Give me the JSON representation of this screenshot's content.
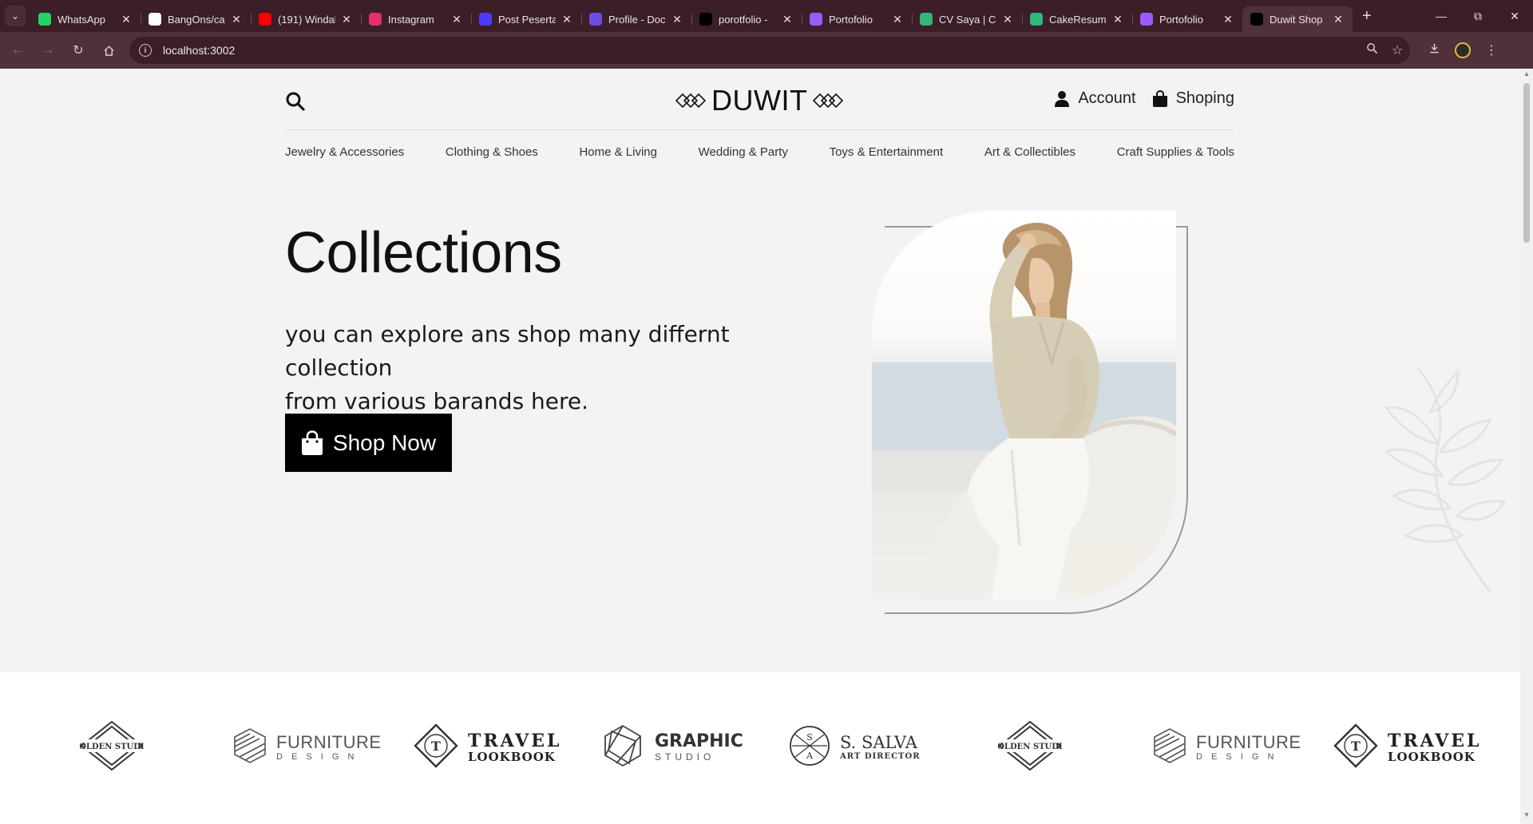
{
  "browser": {
    "tabs": [
      {
        "title": "WhatsApp",
        "icon": "whatsapp-icon",
        "color": "#25d366"
      },
      {
        "title": "BangOns/ca",
        "icon": "github-icon",
        "color": "#ffffff"
      },
      {
        "title": "(191) Windal",
        "icon": "youtube-icon",
        "color": "#ff0000"
      },
      {
        "title": "Instagram",
        "icon": "instagram-icon",
        "color": "#e1306c"
      },
      {
        "title": "Post Peserta",
        "icon": "zoom-icon",
        "color": "#4b3bff"
      },
      {
        "title": "Profile - Doc",
        "icon": "doc-icon",
        "color": "#6c4ee0"
      },
      {
        "title": "porotfolio - ",
        "icon": "vercel-icon",
        "color": "#000000"
      },
      {
        "title": "Portofolio",
        "icon": "vite-icon",
        "color": "#9b5cff"
      },
      {
        "title": "CV Saya | Ca",
        "icon": "cakeresume-icon",
        "color": "#33b679"
      },
      {
        "title": "CakeResume",
        "icon": "cakeresume-icon",
        "color": "#33b679"
      },
      {
        "title": "Portofolio",
        "icon": "vite-icon",
        "color": "#9b5cff"
      },
      {
        "title": "Duwit Shop",
        "icon": "vercel-icon",
        "color": "#000000",
        "active": true
      }
    ],
    "url": "localhost:3002"
  },
  "header": {
    "logo": "DUWIT",
    "account_label": "Account",
    "cart_label": "Shoping"
  },
  "categories": [
    "Jewelry & Accessories",
    "Clothing & Shoes",
    "Home & Living",
    "Wedding & Party",
    "Toys & Entertainment",
    "Art & Collectibles",
    "Craft Supplies & Tools"
  ],
  "hero": {
    "title": "Collections",
    "subtitle_line1": "you can explore ans shop many differnt collection",
    "subtitle_line2": "from various barands here.",
    "cta": "Shop Now"
  },
  "brands": [
    {
      "name": "golden-studio",
      "line1": "GOLDEN STUDIO",
      "line2": ""
    },
    {
      "name": "furniture-design",
      "line1": "FURNITURE",
      "line2": "D E S I G N"
    },
    {
      "name": "travel-lookbook",
      "line1": "TRAVEL",
      "line2": "LOOKBOOK"
    },
    {
      "name": "graphic-studio",
      "line1": "GRAPHIC",
      "line2": "STUDIO"
    },
    {
      "name": "s-salva",
      "line1": "S. SALVA",
      "line2": "ART DIRECTOR"
    },
    {
      "name": "golden-studio",
      "line1": "GOLDEN STUDIO",
      "line2": ""
    },
    {
      "name": "furniture-design",
      "line1": "FURNITURE",
      "line2": "D E S I G N"
    },
    {
      "name": "travel-lookbook",
      "line1": "TRAVEL",
      "line2": "LOOKBOOK"
    }
  ],
  "colors": {
    "chrome_dark": "#3b1e27",
    "chrome_toolbar": "#50303b",
    "page_bg": "#f3f3f3",
    "button_bg": "#000000"
  }
}
